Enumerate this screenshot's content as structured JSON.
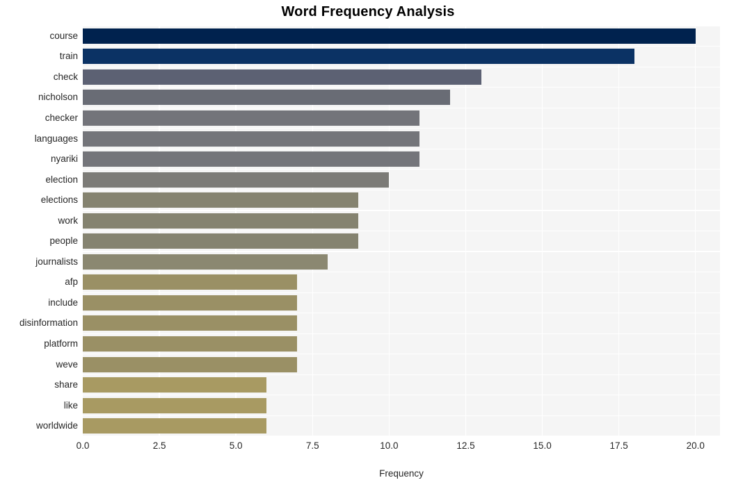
{
  "chart_data": {
    "type": "bar",
    "orientation": "horizontal",
    "title": "Word Frequency Analysis",
    "xlabel": "Frequency",
    "ylabel": "",
    "xlim": [
      0,
      20.8
    ],
    "xticks": [
      "0.0",
      "2.5",
      "5.0",
      "7.5",
      "10.0",
      "12.5",
      "15.0",
      "17.5",
      "20.0"
    ],
    "xtick_values": [
      0,
      2.5,
      5,
      7.5,
      10,
      12.5,
      15,
      17.5,
      20
    ],
    "grid": true,
    "legend": null,
    "categories": [
      "course",
      "train",
      "check",
      "nicholson",
      "checker",
      "languages",
      "nyariki",
      "election",
      "elections",
      "work",
      "people",
      "journalists",
      "afp",
      "include",
      "disinformation",
      "platform",
      "weve",
      "share",
      "like",
      "worldwide"
    ],
    "values": [
      20,
      18,
      13,
      12,
      11,
      11,
      11,
      10,
      9,
      9,
      9,
      8,
      7,
      7,
      7,
      7,
      7,
      6,
      6,
      6
    ],
    "bar_colors": [
      "#00224e",
      "#0b3264",
      "#5c6173",
      "#696c75",
      "#73747a",
      "#74757a",
      "#74757a",
      "#7c7b77",
      "#858370",
      "#858370",
      "#858370",
      "#8b8871",
      "#9a9065",
      "#9a9065",
      "#9a9065",
      "#9a9065",
      "#9a9065",
      "#a89a62",
      "#a89a62",
      "#a89a62"
    ],
    "plot_background": "#f5f5f5",
    "grid_color": "#ffffff",
    "tick_label_color": "#262626"
  }
}
